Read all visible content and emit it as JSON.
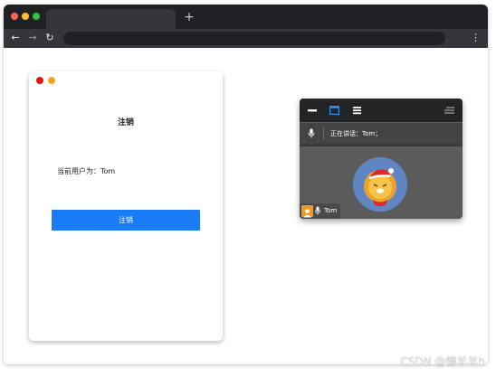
{
  "browser": {
    "new_tab_label": "+",
    "back_label": "←",
    "forward_label": "→",
    "reload_label": "↻",
    "menu_label": "⋮"
  },
  "logout_card": {
    "title": "注销",
    "current_user": "当前用户为：Tom",
    "button_label": "注销",
    "accent_color": "#1a7cf4"
  },
  "call_widget": {
    "speaking_status": "正在讲话：Tom；",
    "participant_name": "Tom",
    "icons": [
      "minimize-icon",
      "window-icon",
      "list-icon",
      "menu-icon",
      "microphone-icon",
      "user-icon"
    ]
  },
  "watermark": "CSDN @懒羊羊h"
}
